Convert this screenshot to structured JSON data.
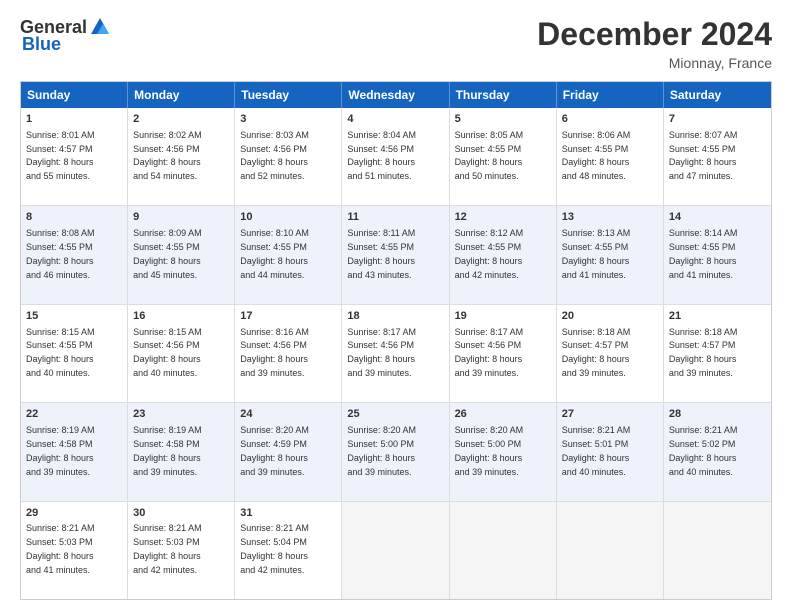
{
  "logo": {
    "general": "General",
    "blue": "Blue"
  },
  "title": "December 2024",
  "location": "Mionnay, France",
  "days": [
    "Sunday",
    "Monday",
    "Tuesday",
    "Wednesday",
    "Thursday",
    "Friday",
    "Saturday"
  ],
  "weeks": [
    [
      {
        "day": "1",
        "info": "Sunrise: 8:01 AM\nSunset: 4:57 PM\nDaylight: 8 hours\nand 55 minutes."
      },
      {
        "day": "2",
        "info": "Sunrise: 8:02 AM\nSunset: 4:56 PM\nDaylight: 8 hours\nand 54 minutes."
      },
      {
        "day": "3",
        "info": "Sunrise: 8:03 AM\nSunset: 4:56 PM\nDaylight: 8 hours\nand 52 minutes."
      },
      {
        "day": "4",
        "info": "Sunrise: 8:04 AM\nSunset: 4:56 PM\nDaylight: 8 hours\nand 51 minutes."
      },
      {
        "day": "5",
        "info": "Sunrise: 8:05 AM\nSunset: 4:55 PM\nDaylight: 8 hours\nand 50 minutes."
      },
      {
        "day": "6",
        "info": "Sunrise: 8:06 AM\nSunset: 4:55 PM\nDaylight: 8 hours\nand 48 minutes."
      },
      {
        "day": "7",
        "info": "Sunrise: 8:07 AM\nSunset: 4:55 PM\nDaylight: 8 hours\nand 47 minutes."
      }
    ],
    [
      {
        "day": "8",
        "info": "Sunrise: 8:08 AM\nSunset: 4:55 PM\nDaylight: 8 hours\nand 46 minutes."
      },
      {
        "day": "9",
        "info": "Sunrise: 8:09 AM\nSunset: 4:55 PM\nDaylight: 8 hours\nand 45 minutes."
      },
      {
        "day": "10",
        "info": "Sunrise: 8:10 AM\nSunset: 4:55 PM\nDaylight: 8 hours\nand 44 minutes."
      },
      {
        "day": "11",
        "info": "Sunrise: 8:11 AM\nSunset: 4:55 PM\nDaylight: 8 hours\nand 43 minutes."
      },
      {
        "day": "12",
        "info": "Sunrise: 8:12 AM\nSunset: 4:55 PM\nDaylight: 8 hours\nand 42 minutes."
      },
      {
        "day": "13",
        "info": "Sunrise: 8:13 AM\nSunset: 4:55 PM\nDaylight: 8 hours\nand 41 minutes."
      },
      {
        "day": "14",
        "info": "Sunrise: 8:14 AM\nSunset: 4:55 PM\nDaylight: 8 hours\nand 41 minutes."
      }
    ],
    [
      {
        "day": "15",
        "info": "Sunrise: 8:15 AM\nSunset: 4:55 PM\nDaylight: 8 hours\nand 40 minutes."
      },
      {
        "day": "16",
        "info": "Sunrise: 8:15 AM\nSunset: 4:56 PM\nDaylight: 8 hours\nand 40 minutes."
      },
      {
        "day": "17",
        "info": "Sunrise: 8:16 AM\nSunset: 4:56 PM\nDaylight: 8 hours\nand 39 minutes."
      },
      {
        "day": "18",
        "info": "Sunrise: 8:17 AM\nSunset: 4:56 PM\nDaylight: 8 hours\nand 39 minutes."
      },
      {
        "day": "19",
        "info": "Sunrise: 8:17 AM\nSunset: 4:56 PM\nDaylight: 8 hours\nand 39 minutes."
      },
      {
        "day": "20",
        "info": "Sunrise: 8:18 AM\nSunset: 4:57 PM\nDaylight: 8 hours\nand 39 minutes."
      },
      {
        "day": "21",
        "info": "Sunrise: 8:18 AM\nSunset: 4:57 PM\nDaylight: 8 hours\nand 39 minutes."
      }
    ],
    [
      {
        "day": "22",
        "info": "Sunrise: 8:19 AM\nSunset: 4:58 PM\nDaylight: 8 hours\nand 39 minutes."
      },
      {
        "day": "23",
        "info": "Sunrise: 8:19 AM\nSunset: 4:58 PM\nDaylight: 8 hours\nand 39 minutes."
      },
      {
        "day": "24",
        "info": "Sunrise: 8:20 AM\nSunset: 4:59 PM\nDaylight: 8 hours\nand 39 minutes."
      },
      {
        "day": "25",
        "info": "Sunrise: 8:20 AM\nSunset: 5:00 PM\nDaylight: 8 hours\nand 39 minutes."
      },
      {
        "day": "26",
        "info": "Sunrise: 8:20 AM\nSunset: 5:00 PM\nDaylight: 8 hours\nand 39 minutes."
      },
      {
        "day": "27",
        "info": "Sunrise: 8:21 AM\nSunset: 5:01 PM\nDaylight: 8 hours\nand 40 minutes."
      },
      {
        "day": "28",
        "info": "Sunrise: 8:21 AM\nSunset: 5:02 PM\nDaylight: 8 hours\nand 40 minutes."
      }
    ],
    [
      {
        "day": "29",
        "info": "Sunrise: 8:21 AM\nSunset: 5:03 PM\nDaylight: 8 hours\nand 41 minutes."
      },
      {
        "day": "30",
        "info": "Sunrise: 8:21 AM\nSunset: 5:03 PM\nDaylight: 8 hours\nand 42 minutes."
      },
      {
        "day": "31",
        "info": "Sunrise: 8:21 AM\nSunset: 5:04 PM\nDaylight: 8 hours\nand 42 minutes."
      },
      null,
      null,
      null,
      null
    ]
  ]
}
